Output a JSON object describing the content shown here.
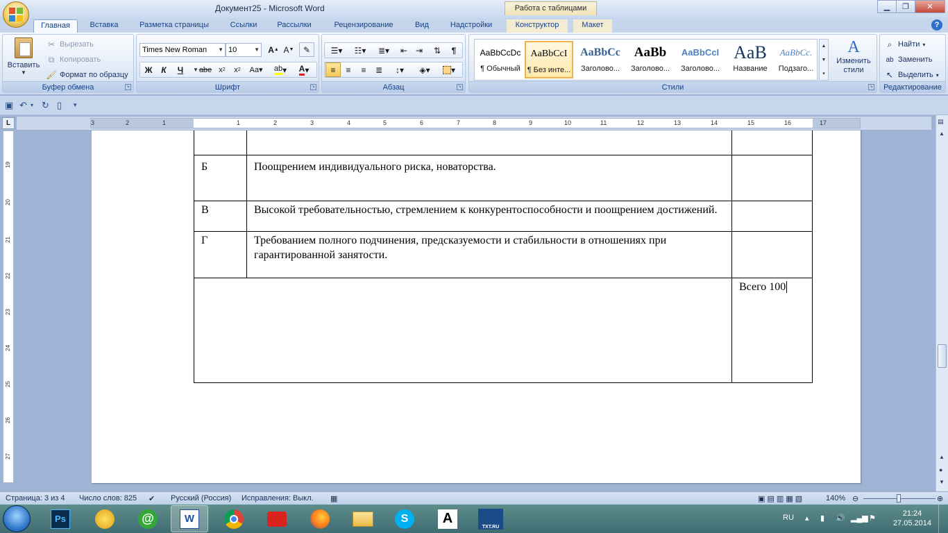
{
  "window": {
    "title": "Документ25 - Microsoft Word",
    "context_tab_header": "Работа с таблицами"
  },
  "tabs": [
    "Главная",
    "Вставка",
    "Разметка страницы",
    "Ссылки",
    "Рассылки",
    "Рецензирование",
    "Вид",
    "Надстройки",
    "Конструктор",
    "Макет"
  ],
  "active_tab": "Главная",
  "clipboard": {
    "paste": "Вставить",
    "cut": "Вырезать",
    "copy": "Копировать",
    "format_painter": "Формат по образцу",
    "label": "Буфер обмена"
  },
  "font": {
    "name": "Times New Roman",
    "size": "10",
    "label": "Шрифт",
    "bold": "Ж",
    "italic": "К",
    "underline": "Ч",
    "strike": "abe",
    "change_case": "Aa"
  },
  "paragraph": {
    "label": "Абзац",
    "pilcrow": "¶"
  },
  "styles": {
    "label": "Стили",
    "items": [
      {
        "sample": "AaBbCcDc",
        "name": "¶ Обычный"
      },
      {
        "sample": "AaBbCcI",
        "name": "¶ Без инте..."
      },
      {
        "sample": "AaBbCc",
        "name": "Заголово..."
      },
      {
        "sample": "AaBb",
        "name": "Заголово..."
      },
      {
        "sample": "AaBbCcI",
        "name": "Заголово..."
      },
      {
        "sample": "AaB",
        "name": "Название"
      },
      {
        "sample": "AaBbCc.",
        "name": "Подзаго..."
      }
    ],
    "change_styles": "Изменить стили"
  },
  "editing": {
    "label": "Редактирование",
    "find": "Найти",
    "replace": "Заменить",
    "select": "Выделить"
  },
  "ruler": {
    "labels": [
      "3",
      "2",
      "1",
      "1",
      "2",
      "3",
      "4",
      "5",
      "6",
      "7",
      "8",
      "9",
      "10",
      "11",
      "12",
      "13",
      "14",
      "15",
      "16",
      "17"
    ],
    "vlabels": [
      "19",
      "20",
      "21",
      "22",
      "23",
      "24",
      "25",
      "26",
      "27"
    ]
  },
  "table": {
    "rows": [
      {
        "letter": "",
        "text": "",
        "score": ""
      },
      {
        "letter": "Б",
        "text": "Поощрением индивидуального риска, новаторства.",
        "score": ""
      },
      {
        "letter": "В",
        "text": "Высокой требовательностью, стремлением к конкурентоспособности и поощрением достижений.",
        "score": ""
      },
      {
        "letter": "Г",
        "text": "Требованием полного подчинения, предсказуемости и стабильности в отношениях при гарантированной занятости.",
        "score": ""
      }
    ],
    "total": "Всего 100"
  },
  "status": {
    "page": "Страница: 3 из 4",
    "words": "Число слов: 825",
    "language": "Русский (Россия)",
    "track_changes": "Исправления: Выкл.",
    "zoom": "140%"
  },
  "taskbar": {
    "apps": [
      "Ps",
      "@",
      "W",
      "A"
    ],
    "txt_label": "TXT.RU",
    "lang": "RU",
    "time": "21:24",
    "date": "27.05.2014"
  }
}
